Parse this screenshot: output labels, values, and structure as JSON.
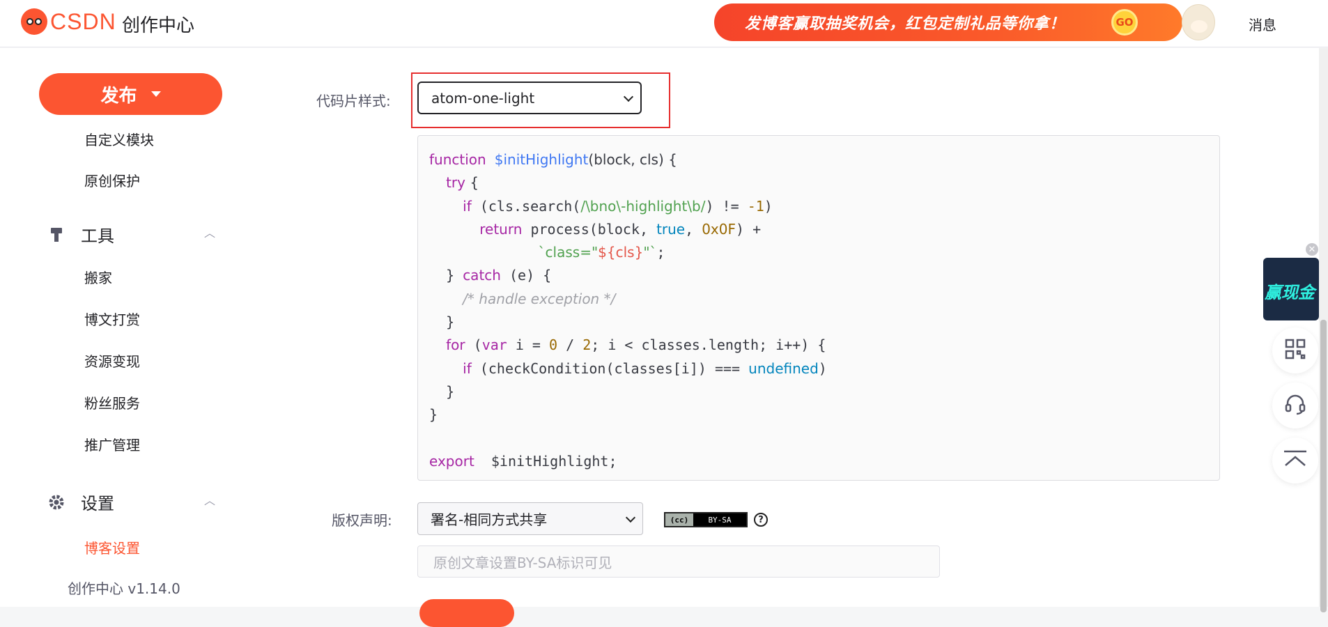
{
  "header": {
    "logo_text": "CSDN",
    "subtitle": "创作中心",
    "banner_text": "发博客赢取抽奖机会，红包定制礼品等你拿！",
    "banner_go": "GO",
    "messages_label": "消息"
  },
  "sidebar": {
    "publish_label": "发布",
    "items_top": [
      "自定义模块",
      "原创保护"
    ],
    "tools_group": "工具",
    "tools_items": [
      "搬家",
      "博文打赏",
      "资源变现",
      "粉丝服务",
      "推广管理"
    ],
    "settings_group": "设置",
    "settings_items": [
      "博客设置"
    ],
    "version": "创作中心 v1.14.0"
  },
  "form": {
    "code_style_label": "代码片样式:",
    "code_style_value": "atom-one-light",
    "copyright_label": "版权声明:",
    "copyright_value": "署名-相同方式共享",
    "cc_badge_left": "(cc)",
    "cc_badge_right": "BY-SA",
    "help_icon": "?",
    "note_placeholder": "原创文章设置BY-SA标识可见"
  },
  "code_preview": {
    "l1_kw": "function",
    "l1_fn": "$initHighlight",
    "l1_rest": "(block, cls) {",
    "l2_kw": "try",
    "l2_rest": " {",
    "l3_kw": "if",
    "l3_a": " (cls.search(",
    "l3_regex": "/\\bno\\-highlight\\b/",
    "l3_b": ") != ",
    "l3_num": "-1",
    "l3_c": ")",
    "l4_kw": "return",
    "l4_a": " process(block, ",
    "l4_true": "true",
    "l4_b": ", ",
    "l4_num": "0x0F",
    "l4_c": ") +",
    "l5_a": "`class=\"",
    "l5_b": "${cls}",
    "l5_c": "\"`",
    "l5_d": ";",
    "l6_a": "} ",
    "l6_kw": "catch",
    "l6_b": " (e) {",
    "l7_cmt": "/* handle exception */",
    "l8": "}",
    "l9_kw": "for",
    "l9_a": " (",
    "l9_kw2": "var",
    "l9_b": " i = ",
    "l9_n1": "0",
    "l9_c": " / ",
    "l9_n2": "2",
    "l9_d": "; i < classes.length; i++) {",
    "l10_kw": "if",
    "l10_a": " (checkCondition(classes[i]) === ",
    "l10_undef": "undefined",
    "l10_b": ")",
    "l11": "}",
    "l12": "}",
    "l14_kw": "export",
    "l14_rest": "  $initHighlight;"
  },
  "float_ad": {
    "text": "赢现金"
  },
  "colors": {
    "brand": "#fc5531",
    "highlight_frame": "#e62e2e"
  },
  "icons": [
    "logo-icon",
    "caret-down-icon",
    "tools-icon",
    "settings-icon",
    "chevron-up-icon",
    "close-icon",
    "qrcode-icon",
    "headset-icon",
    "back-to-top-icon",
    "help-icon"
  ]
}
